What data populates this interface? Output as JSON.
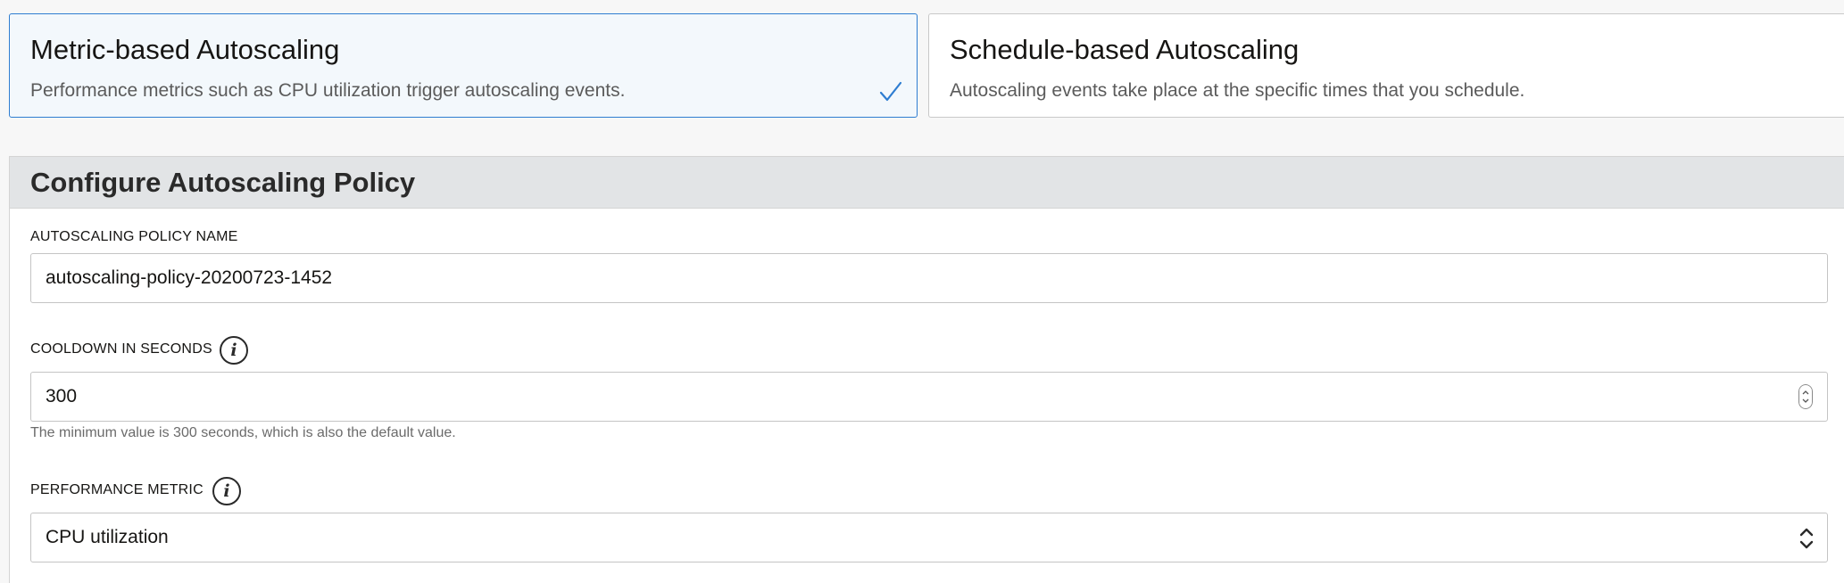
{
  "options": {
    "metric": {
      "title": "Metric-based Autoscaling",
      "description": "Performance metrics such as CPU utilization trigger autoscaling events.",
      "selected": true,
      "icon": "check-icon"
    },
    "schedule": {
      "title": "Schedule-based Autoscaling",
      "description": "Autoscaling events take place at the specific times that you schedule.",
      "selected": false
    }
  },
  "colors": {
    "accent": "#2e7dd1",
    "selected_background": "#f3f8fc",
    "panel_header": "#e2e4e6"
  },
  "policy": {
    "title": "Configure Autoscaling Policy",
    "name_field": {
      "label": "AUTOSCALING POLICY NAME",
      "value": "autoscaling-policy-20200723-1452"
    },
    "cooldown_field": {
      "label": "COOLDOWN IN SECONDS",
      "value": "300",
      "help": "The minimum value is 300 seconds, which is also the default value.",
      "icon": "info-icon"
    },
    "metric_field": {
      "label": "PERFORMANCE METRIC",
      "value": "CPU utilization",
      "icon": "info-icon"
    }
  }
}
